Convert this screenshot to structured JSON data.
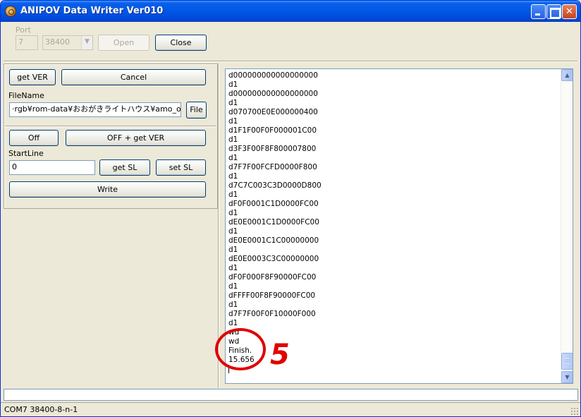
{
  "window": {
    "title": "ANIPOV Data Writer Ver010"
  },
  "port": {
    "label": "Port",
    "port_value": "7",
    "baud_value": "38400",
    "open_label": "Open",
    "close_label": "Close"
  },
  "controls": {
    "get_ver_label": "get VER",
    "cancel_label": "Cancel",
    "filename_label": "FileName",
    "filename_value": "·rgb¥rom-data¥おおがきライトハウス¥amo_only.csv",
    "file_button_label": "File",
    "off_label": "Off",
    "off_get_ver_label": "OFF + get VER",
    "startline_label": "StartLine",
    "startline_value": "0",
    "get_sl_label": "get SL",
    "set_sl_label": "set SL",
    "write_label": "Write"
  },
  "log": {
    "lines": [
      "d000000000000000000",
      "d1",
      "d000000000000000000",
      "d1",
      "d070700E0E000000400",
      "d1",
      "d1F1F00F0F000001C00",
      "d1",
      "d3F3F00F8F800007800",
      "d1",
      "d7F7F00FCFD0000F800",
      "d1",
      "d7C7C003C3D0000D800",
      "d1",
      "dF0F0001C1D0000FC00",
      "d1",
      "dE0E0001C1D0000FC00",
      "d1",
      "dE0E0001C1C00000000",
      "d1",
      "dE0E0003C3C00000000",
      "d1",
      "dF0F000F8F90000FC00",
      "d1",
      "dFFFF00F8F90000FC00",
      "d1",
      "d7F7F00F0F10000F000",
      "d1",
      "wd",
      "wd",
      "Finish.",
      "15.656"
    ]
  },
  "annotation": {
    "number": "5",
    "color": "#e00000"
  },
  "status": {
    "text": "COM7 38400-8-n-1"
  },
  "icons": {
    "app": "app-icon",
    "minimize": "minimize-icon",
    "maximize": "maximize-icon",
    "close": "close-icon",
    "scroll_up": "chevron-up-icon",
    "scroll_down": "chevron-down-icon",
    "dropdown": "chevron-down-icon"
  }
}
